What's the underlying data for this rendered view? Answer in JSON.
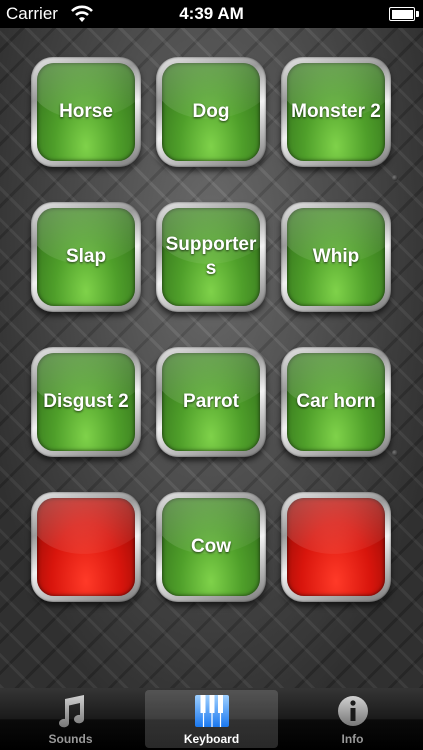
{
  "status_bar": {
    "carrier": "Carrier",
    "time": "4:39 AM"
  },
  "sound_buttons": [
    {
      "label": "Horse",
      "color": "green"
    },
    {
      "label": "Dog",
      "color": "green"
    },
    {
      "label": "Monster 2",
      "color": "green"
    },
    {
      "label": "Slap",
      "color": "green"
    },
    {
      "label": "Supporters",
      "color": "green"
    },
    {
      "label": "Whip",
      "color": "green"
    },
    {
      "label": "Disgust 2",
      "color": "green"
    },
    {
      "label": "Parrot",
      "color": "green"
    },
    {
      "label": "Car horn",
      "color": "green"
    },
    {
      "label": "",
      "color": "red"
    },
    {
      "label": "Cow",
      "color": "green"
    },
    {
      "label": "",
      "color": "red"
    }
  ],
  "tab_bar": {
    "items": [
      {
        "label": "Sounds",
        "icon": "music-note-icon",
        "selected": false
      },
      {
        "label": "Keyboard",
        "icon": "piano-keyboard-icon",
        "selected": true
      },
      {
        "label": "Info",
        "icon": "info-icon",
        "selected": false
      }
    ]
  },
  "colors": {
    "pad_green": "#4f9f2a",
    "pad_red": "#d8150c",
    "keyboard_icon_blue": "#2a8cff"
  }
}
